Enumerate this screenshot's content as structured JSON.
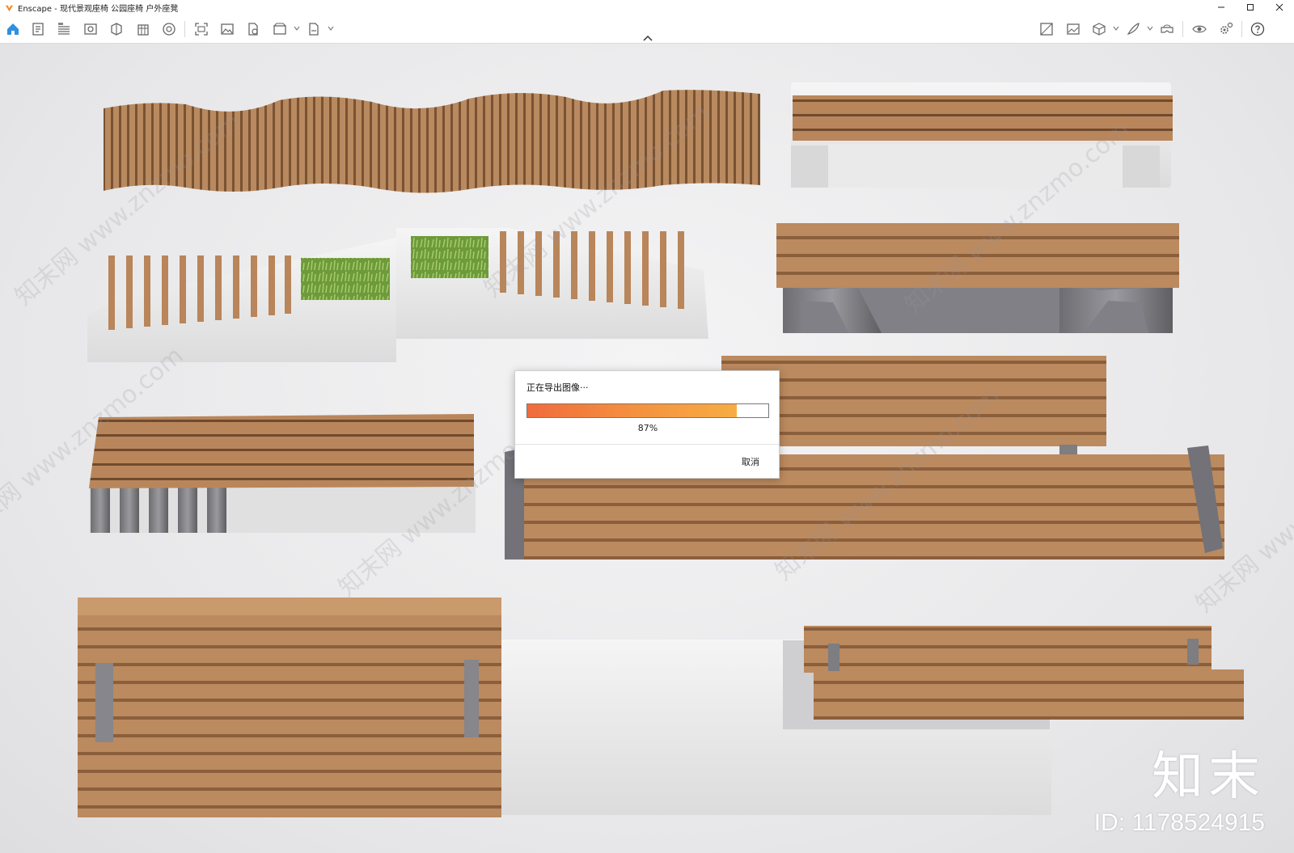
{
  "window": {
    "title": "Enscape - 现代景观座椅 公园座椅 户外座凳",
    "controls": [
      "minimize-icon",
      "maximize-icon",
      "close-icon"
    ]
  },
  "toolbar": {
    "left_icons": [
      "home-icon",
      "project-icon",
      "bim-icon",
      "visibility-icon",
      "asset-library-icon",
      "sites-icon",
      "material-icon",
      "screenshot-icon",
      "image-icon",
      "render-icon",
      "video-icon",
      "export-icon"
    ],
    "right_icons": [
      "view-management-icon",
      "batch-render-icon",
      "cube-icon",
      "feather-icon",
      "vr-headset-icon",
      "eye-icon",
      "settings-icon",
      "help-icon"
    ],
    "accent": "#2f8fe0"
  },
  "dialog": {
    "message": "正在导出图像···",
    "progress": 0.87,
    "progress_label": "87%",
    "cancel_label": "取消"
  },
  "viewport": {
    "watermark_text": "知末网 www.znzmo.com",
    "brand_logo": "知末",
    "brand_id": "ID: 1178524915"
  }
}
